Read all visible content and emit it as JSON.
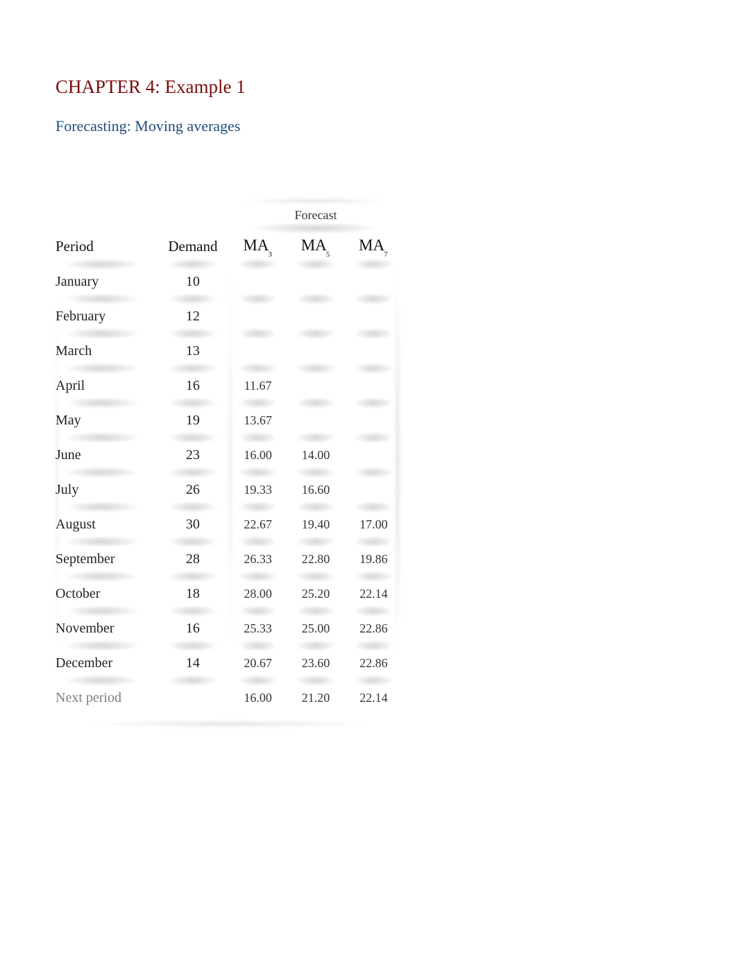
{
  "title": "CHAPTER 4: Example 1",
  "subtitle": "Forecasting: Moving averages",
  "forecast_header": "Forecast",
  "columns": {
    "period": "Period",
    "demand": "Demand",
    "ma": "MA",
    "sub3": "3",
    "sub5": "5",
    "sub7": "7"
  },
  "rows": [
    {
      "period": "January",
      "demand": "10",
      "ma3": "",
      "ma5": "",
      "ma7": ""
    },
    {
      "period": "February",
      "demand": "12",
      "ma3": "",
      "ma5": "",
      "ma7": ""
    },
    {
      "period": "March",
      "demand": "13",
      "ma3": "",
      "ma5": "",
      "ma7": ""
    },
    {
      "period": "April",
      "demand": "16",
      "ma3": "11.67",
      "ma5": "",
      "ma7": ""
    },
    {
      "period": "May",
      "demand": "19",
      "ma3": "13.67",
      "ma5": "",
      "ma7": ""
    },
    {
      "period": "June",
      "demand": "23",
      "ma3": "16.00",
      "ma5": "14.00",
      "ma7": ""
    },
    {
      "period": "July",
      "demand": "26",
      "ma3": "19.33",
      "ma5": "16.60",
      "ma7": ""
    },
    {
      "period": "August",
      "demand": "30",
      "ma3": "22.67",
      "ma5": "19.40",
      "ma7": "17.00"
    },
    {
      "period": "September",
      "demand": "28",
      "ma3": "26.33",
      "ma5": "22.80",
      "ma7": "19.86"
    },
    {
      "period": "October",
      "demand": "18",
      "ma3": "28.00",
      "ma5": "25.20",
      "ma7": "22.14"
    },
    {
      "period": "November",
      "demand": "16",
      "ma3": "25.33",
      "ma5": "25.00",
      "ma7": "22.86"
    },
    {
      "period": "December",
      "demand": "14",
      "ma3": "20.67",
      "ma5": "23.60",
      "ma7": "22.86"
    },
    {
      "period": "Next period",
      "demand": "",
      "ma3": "16.00",
      "ma5": "21.20",
      "ma7": "22.14",
      "muted": true
    }
  ],
  "chart_data": {
    "type": "table",
    "title": "Forecasting: Moving averages",
    "columns": [
      "Period",
      "Demand",
      "MA3",
      "MA5",
      "MA7"
    ],
    "rows": [
      [
        "January",
        10,
        null,
        null,
        null
      ],
      [
        "February",
        12,
        null,
        null,
        null
      ],
      [
        "March",
        13,
        null,
        null,
        null
      ],
      [
        "April",
        16,
        11.67,
        null,
        null
      ],
      [
        "May",
        19,
        13.67,
        null,
        null
      ],
      [
        "June",
        23,
        16.0,
        14.0,
        null
      ],
      [
        "July",
        26,
        19.33,
        16.6,
        null
      ],
      [
        "August",
        30,
        22.67,
        19.4,
        17.0
      ],
      [
        "September",
        28,
        26.33,
        22.8,
        19.86
      ],
      [
        "October",
        18,
        28.0,
        25.2,
        22.14
      ],
      [
        "November",
        16,
        25.33,
        25.0,
        22.86
      ],
      [
        "December",
        14,
        20.67,
        23.6,
        22.86
      ],
      [
        "Next period",
        null,
        16.0,
        21.2,
        22.14
      ]
    ]
  }
}
